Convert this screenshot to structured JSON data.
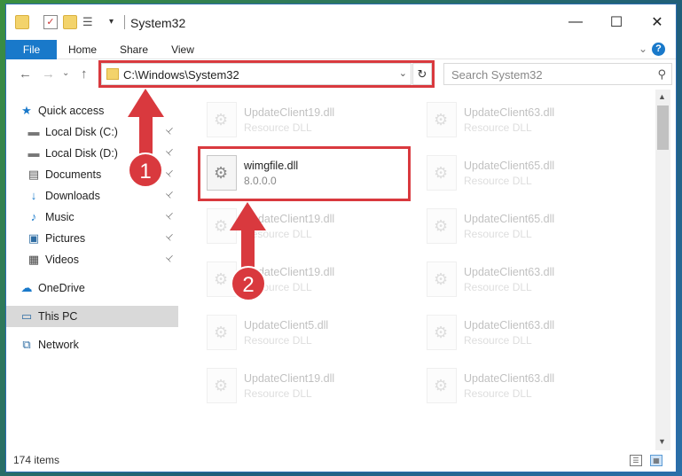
{
  "window": {
    "title": "System32",
    "minimize_glyph": "—",
    "maximize_glyph": "☐",
    "close_glyph": "✕"
  },
  "ribbon": {
    "tabs": [
      "File",
      "Home",
      "Share",
      "View"
    ],
    "help_glyph": "?",
    "expand_glyph": "⌄"
  },
  "nav": {
    "back_glyph": "←",
    "forward_glyph": "→",
    "recent_glyph": "⌄",
    "up_glyph": "↑",
    "address": "C:\\Windows\\System32",
    "address_dropdown_glyph": "⌄",
    "refresh_glyph": "↻",
    "search_placeholder": "Search System32",
    "search_glyph": "⚲"
  },
  "sidebar": {
    "items": [
      {
        "label": "Quick access",
        "icon": "star-icon",
        "glyph": "★",
        "color": "#1979ca"
      },
      {
        "label": "Local Disk (C:)",
        "icon": "drive-icon",
        "glyph": "▬",
        "color": "#777777",
        "pinned": true
      },
      {
        "label": "Local Disk (D:)",
        "icon": "drive-icon",
        "glyph": "▬",
        "color": "#777777",
        "pinned": true
      },
      {
        "label": "Documents",
        "icon": "documents-icon",
        "glyph": "▤",
        "color": "#555555",
        "pinned": true
      },
      {
        "label": "Downloads",
        "icon": "download-icon",
        "glyph": "↓",
        "color": "#1979ca",
        "pinned": true
      },
      {
        "label": "Music",
        "icon": "music-icon",
        "glyph": "♪",
        "color": "#1979ca",
        "pinned": true
      },
      {
        "label": "Pictures",
        "icon": "pictures-icon",
        "glyph": "▣",
        "color": "#2f6da3",
        "pinned": true
      },
      {
        "label": "Videos",
        "icon": "videos-icon",
        "glyph": "▦",
        "color": "#444444",
        "pinned": true
      },
      {
        "label": "OneDrive",
        "icon": "cloud-icon",
        "glyph": "☁",
        "color": "#1979ca"
      },
      {
        "label": "This PC",
        "icon": "computer-icon",
        "glyph": "▭",
        "color": "#2f6da3",
        "selected": true
      },
      {
        "label": "Network",
        "icon": "network-icon",
        "glyph": "⧉",
        "color": "#2f6da3"
      }
    ],
    "pin_glyph": "📌"
  },
  "files": [
    {
      "name": "UpdateClient19.dll",
      "desc": "Resource DLL",
      "faded": true
    },
    {
      "name": "UpdateClient63.dll",
      "desc": "Resource DLL",
      "faded": true
    },
    {
      "name": "wimgfile.dll",
      "desc": "8.0.0.0",
      "faded": false,
      "highlighted": true
    },
    {
      "name": "UpdateClient65.dll",
      "desc": "Resource DLL",
      "faded": true
    },
    {
      "name": "UpdateClient19.dll",
      "desc": "Resource DLL",
      "faded": true
    },
    {
      "name": "UpdateClient65.dll",
      "desc": "Resource DLL",
      "faded": true
    },
    {
      "name": "UpdateClient19.dll",
      "desc": "Resource DLL",
      "faded": true
    },
    {
      "name": "UpdateClient63.dll",
      "desc": "Resource DLL",
      "faded": true
    },
    {
      "name": "UpdateClient5.dll",
      "desc": "Resource DLL",
      "faded": true
    },
    {
      "name": "UpdateClient63.dll",
      "desc": "Resource DLL",
      "faded": true
    },
    {
      "name": "UpdateClient19.dll",
      "desc": "Resource DLL",
      "faded": true
    },
    {
      "name": "UpdateClient63.dll",
      "desc": "Resource DLL",
      "faded": true
    }
  ],
  "status": {
    "item_count": "174 items"
  },
  "annotations": {
    "step1": "1",
    "step2": "2",
    "color": "#d9393e"
  }
}
